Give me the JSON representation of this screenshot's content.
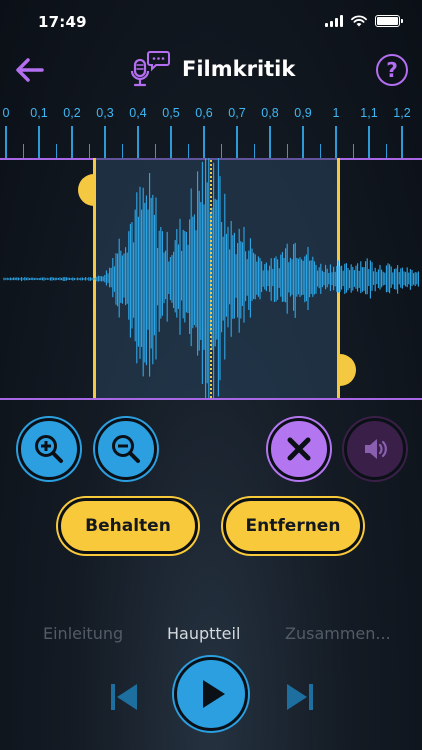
{
  "status_bar": {
    "time": "17:49"
  },
  "header": {
    "title": "Filmkritik"
  },
  "ruler": {
    "labels": [
      "0",
      "0,1",
      "0,2",
      "0,3",
      "0,4",
      "0,5",
      "0,6",
      "0,7",
      "0,8",
      "0,9",
      "1",
      "1,1",
      "1,2"
    ]
  },
  "selection": {
    "start_seconds": 0.28,
    "end_seconds": 1.03,
    "playhead_seconds": 0.63
  },
  "buttons": {
    "keep_label": "Behalten",
    "remove_label": "Entfernen"
  },
  "sections": [
    {
      "label": "Einleitung",
      "active": false
    },
    {
      "label": "Hauptteil",
      "active": true
    },
    {
      "label": "Zusammen...",
      "active": false
    }
  ],
  "icons": {
    "back": "arrow-left-icon",
    "logo": "microphone-speech-icon",
    "help": "question-icon",
    "zoom_in": "zoom-in-icon",
    "zoom_out": "zoom-out-icon",
    "close": "close-icon",
    "sound": "speaker-icon",
    "previous": "skip-previous-icon",
    "play": "play-icon",
    "next": "skip-next-icon"
  },
  "colors": {
    "accent_blue": "#2b9fe0",
    "accent_purple": "#b476f0",
    "accent_yellow": "#f8c93a",
    "background": "#0b1017"
  }
}
